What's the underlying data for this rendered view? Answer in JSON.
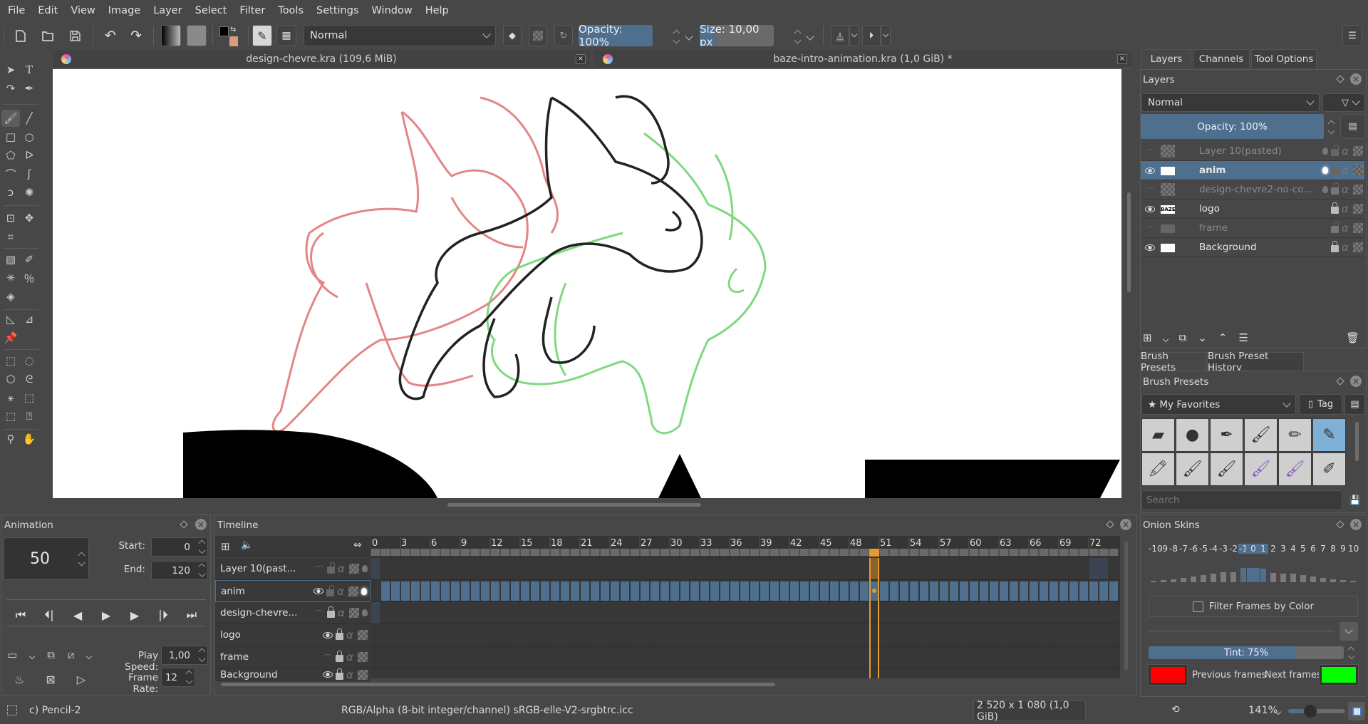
{
  "menubar": {
    "items": [
      "File",
      "Edit",
      "View",
      "Image",
      "Layer",
      "Select",
      "Filter",
      "Tools",
      "Settings",
      "Window",
      "Help"
    ]
  },
  "toolbar": {
    "blend_mode": "Normal",
    "opacity_label": "Opacity: 100%",
    "opacity_value": 100,
    "size_label": "Size: 10,00 px",
    "size_value": 10.0,
    "fg_color": "#000000",
    "bg_color": "#d79c7e"
  },
  "documents": [
    {
      "title": "design-chevre.kra (109,6 MiB)",
      "active": false
    },
    {
      "title": "baze-intro-animation.kra (1,0 GiB) *",
      "active": true
    }
  ],
  "right_panel": {
    "tabs": [
      "Layers",
      "Channels",
      "Tool Options"
    ],
    "active_tab": "Layers",
    "layers_docker": {
      "title": "Layers",
      "blend_mode": "Normal",
      "opacity_label": "Opacity:  100%",
      "layers": [
        {
          "name": "Layer 10(pasted)",
          "visible": false,
          "selected": false,
          "locked": false,
          "onion": true
        },
        {
          "name": "anim",
          "visible": true,
          "selected": true,
          "locked": false,
          "onion": true
        },
        {
          "name": "design-chevre2-no-co...",
          "visible": false,
          "selected": false,
          "locked": true,
          "onion": true
        },
        {
          "name": "logo",
          "visible": true,
          "selected": false,
          "locked": true,
          "onion": false
        },
        {
          "name": "frame",
          "visible": false,
          "selected": false,
          "locked": true,
          "onion": false
        },
        {
          "name": "Background",
          "visible": true,
          "selected": false,
          "locked": true,
          "onion": false
        }
      ]
    },
    "brush_tabs": [
      "Brush Presets",
      "Brush Preset History"
    ],
    "brush_presets": {
      "title": "Brush Presets",
      "tag_filter": "★ My Favorites",
      "tag_button": "Tag",
      "search_placeholder": "Search",
      "presets": [
        "eraser-hard",
        "eraser-soft",
        "airbrush",
        "paint-brush",
        "pencil-blue",
        "pencil-2",
        "marker-blender",
        "bristles-wet",
        "bristles-dry",
        "watercolor-purple",
        "watercolor-purple-fine",
        "white-blender"
      ],
      "selected_index": 5
    },
    "onion_skins": {
      "title": "Onion Skins",
      "frames": [
        "-10",
        "-9",
        "-8",
        "-7",
        "-6",
        "-5",
        "-4",
        "-3",
        "-2",
        "-1",
        "0",
        "1",
        "2",
        "3",
        "4",
        "5",
        "6",
        "7",
        "8",
        "9",
        "10"
      ],
      "active_frames": [
        "-1",
        "0",
        "1"
      ],
      "opacity_levels": [
        0.06,
        0.12,
        0.15,
        0.22,
        0.3,
        0.38,
        0.45,
        0.55,
        0.55,
        0.75,
        0.75,
        0.72,
        0.5,
        0.45,
        0.45,
        0.38,
        0.3,
        0.22,
        0.15,
        0.12,
        0.06
      ],
      "filter_label": "Filter Frames by Color",
      "tint_label": "Tint: 75%",
      "tint_value": 75,
      "previous_label": "Previous frames",
      "next_label": "Next frames",
      "previous_color": "#ff0000",
      "next_color": "#00ff00"
    }
  },
  "animation": {
    "title": "Animation",
    "current_frame": "50",
    "start_label": "Start:",
    "start_value": "0",
    "end_label": "End:",
    "end_value": "120",
    "play_speed_label": "Play Speed:",
    "play_speed_value": "1,00",
    "frame_rate_label": "Frame Rate:",
    "frame_rate_value": "12"
  },
  "timeline": {
    "title": "Timeline",
    "ruler": [
      "0",
      "3",
      "6",
      "9",
      "12",
      "15",
      "18",
      "21",
      "24",
      "27",
      "30",
      "33",
      "36",
      "39",
      "42",
      "45",
      "48",
      "51",
      "54",
      "57",
      "60",
      "63",
      "66",
      "69",
      "72"
    ],
    "current_frame": 50,
    "layers": [
      {
        "name": "Layer 10(past...",
        "visible": false
      },
      {
        "name": "anim",
        "visible": true,
        "selected": true
      },
      {
        "name": "design-chevre...",
        "visible": false
      },
      {
        "name": "logo",
        "visible": true
      },
      {
        "name": "frame",
        "visible": false
      },
      {
        "name": "Background",
        "visible": true
      }
    ],
    "keyframe_color": "#4f6f8f",
    "playhead_color": "#e59a30"
  },
  "status": {
    "brush": "c) Pencil-2",
    "color_space": "RGB/Alpha (8-bit integer/channel)  sRGB-elle-V2-srgbtrc.icc",
    "dimensions": "2 520 x 1 080 (1,0 GiB)",
    "zoom": "141%"
  }
}
